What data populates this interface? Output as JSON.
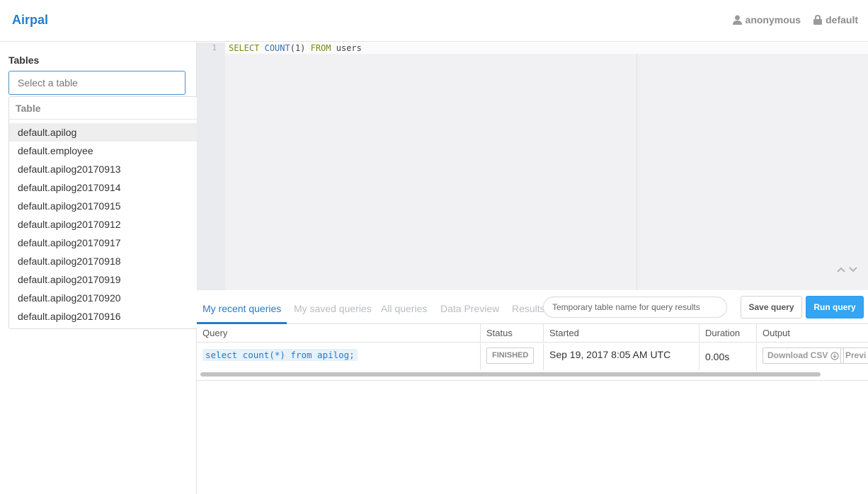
{
  "app": {
    "brand": "Airpal"
  },
  "user": {
    "name": "anonymous",
    "schema": "default"
  },
  "sidebar": {
    "title": "Tables",
    "search_placeholder": "Select a table",
    "dropdown_header": "Table",
    "tables": [
      "default.apilog",
      "default.employee",
      "default.apilog20170913",
      "default.apilog20170914",
      "default.apilog20170915",
      "default.apilog20170912",
      "default.apilog20170917",
      "default.apilog20170918",
      "default.apilog20170919",
      "default.apilog20170920",
      "default.apilog20170916"
    ],
    "highlighted_index": 0
  },
  "editor": {
    "line_number": "1",
    "tokens": [
      {
        "text": "SELECT",
        "kind": "keyword"
      },
      {
        "text": " ",
        "kind": "plain"
      },
      {
        "text": "COUNT",
        "kind": "function"
      },
      {
        "text": "(1) ",
        "kind": "plain"
      },
      {
        "text": "FROM",
        "kind": "keyword"
      },
      {
        "text": " users",
        "kind": "plain"
      }
    ]
  },
  "tabs": [
    {
      "label": "My recent queries",
      "active": true
    },
    {
      "label": "My saved queries",
      "active": false
    },
    {
      "label": "All queries",
      "active": false
    },
    {
      "label": "Data Preview",
      "active": false
    },
    {
      "label": "Results",
      "active": false
    }
  ],
  "toolbar": {
    "temp_table_placeholder": "Temporary table name for query results",
    "save_label": "Save query",
    "run_label": "Run query"
  },
  "results_table": {
    "columns": [
      "Query",
      "Status",
      "Started",
      "Duration",
      "Output"
    ],
    "rows": [
      {
        "query": "select count(*) from apilog;",
        "status": "FINISHED",
        "started": "Sep 19, 2017 8:05 AM UTC",
        "duration": "0.00s",
        "download_label": "Download CSV",
        "preview_label": "Previ"
      }
    ]
  },
  "colors": {
    "brand": "#1f7fd1",
    "accent": "#2a79c4",
    "run_button": "#34a4f5",
    "sql_keyword": "#7a8b1a",
    "sql_function": "#3d6fb0"
  }
}
